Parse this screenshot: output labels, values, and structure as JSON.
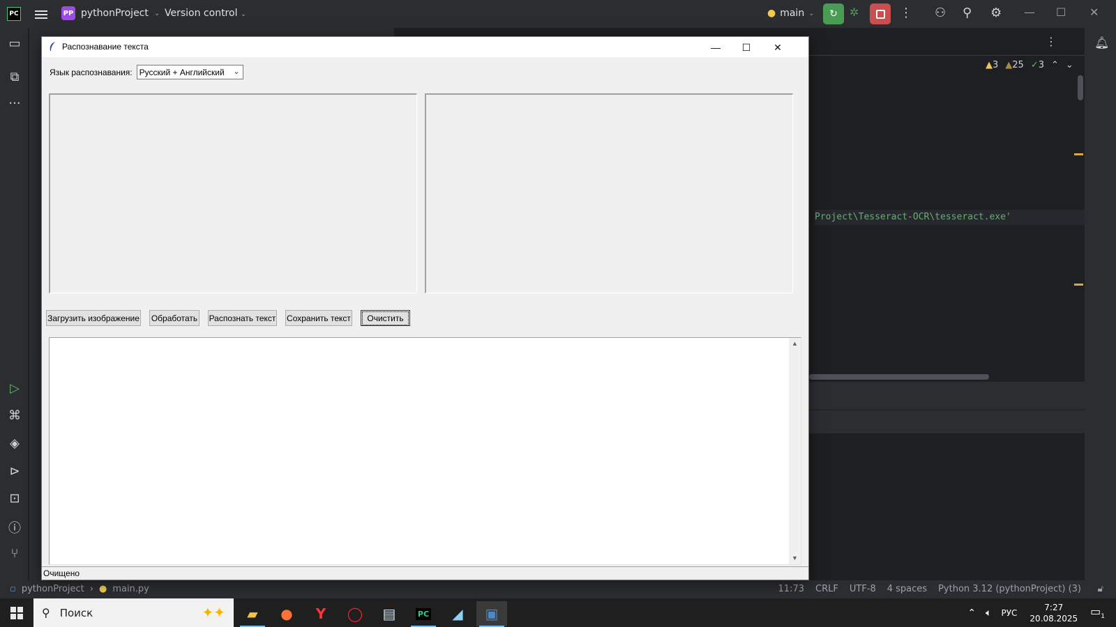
{
  "ide": {
    "logo": "PC",
    "project_badge": "PP",
    "project_name": "pythonProject",
    "version_control": "Version control",
    "branch": "main",
    "inspections": {
      "warnings": "3",
      "weak_warnings": "25",
      "ok": "3"
    },
    "code_fragment": "Project\\Tesseract-OCR\\tesseract.exe'",
    "status": {
      "breadcrumb_project": "pythonProject",
      "breadcrumb_file": "main.py",
      "position": "11:73",
      "line_sep": "CRLF",
      "encoding": "UTF-8",
      "indent": "4 spaces",
      "interpreter": "Python 3.12 (pythonProject) (3)"
    },
    "colors": {
      "bg": "#1e1f22",
      "panel": "#2b2d30",
      "run": "#499c54",
      "stop": "#c94f4f",
      "string": "#6aab73",
      "marker": "#d6a94a"
    }
  },
  "app": {
    "title": "Распознавание текста",
    "language_label": "Язык распознавания:",
    "language_value": "Русский + Английский",
    "buttons": {
      "load": "Загрузить изображение",
      "process": "Обработать",
      "recognize": "Распознать текст",
      "save": "Сохранить текст",
      "clear": "Очистить"
    },
    "result_text": "",
    "status": "Очищено"
  },
  "taskbar": {
    "search_placeholder": "Поиск",
    "language": "РУС",
    "time": "7:27",
    "date": "20.08.2025",
    "notifications": "1",
    "apps": [
      "file-explorer",
      "firefox",
      "yandex-browser",
      "opera",
      "news",
      "pycharm",
      "notepad",
      "python-tk"
    ]
  }
}
